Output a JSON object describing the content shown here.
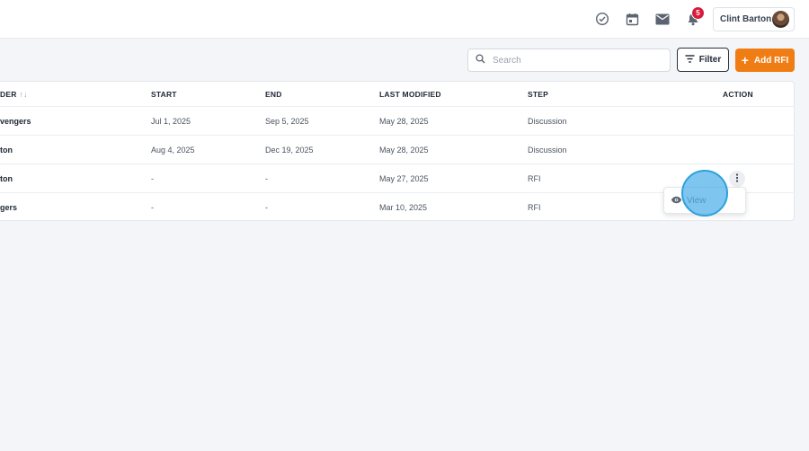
{
  "header": {
    "icons": [
      "check-circle-icon",
      "calendar-icon",
      "mail-icon",
      "bell-icon"
    ],
    "notification_count": "5",
    "user_name": "Clint Barton"
  },
  "toolbar": {
    "search_placeholder": "Search",
    "filter_label": "Filter",
    "add_label": "Add RFI"
  },
  "table": {
    "columns": {
      "first": "DER",
      "first_sort": "↑↓",
      "start": "START",
      "end": "END",
      "last_modified": "LAST MODIFIED",
      "step": "STEP",
      "action": "ACTION"
    },
    "rows": [
      {
        "name": "vengers",
        "start": "Jul 1, 2025",
        "end": "Sep 5, 2025",
        "last_modified": "May 28, 2025",
        "step": "Discussion"
      },
      {
        "name": "ton",
        "start": "Aug 4, 2025",
        "end": "Dec 19, 2025",
        "last_modified": "May 28, 2025",
        "step": "Discussion"
      },
      {
        "name": "ton",
        "start": "-",
        "end": "-",
        "last_modified": "May 27, 2025",
        "step": "RFI"
      },
      {
        "name": "gers",
        "start": "-",
        "end": "-",
        "last_modified": "Mar 10, 2025",
        "step": "RFI"
      }
    ]
  },
  "row_menu": {
    "view_label": "View"
  },
  "colors": {
    "accent_orange": "#f07d13",
    "badge_red": "#d81b3c",
    "click_highlight": "#4cb0ea"
  }
}
